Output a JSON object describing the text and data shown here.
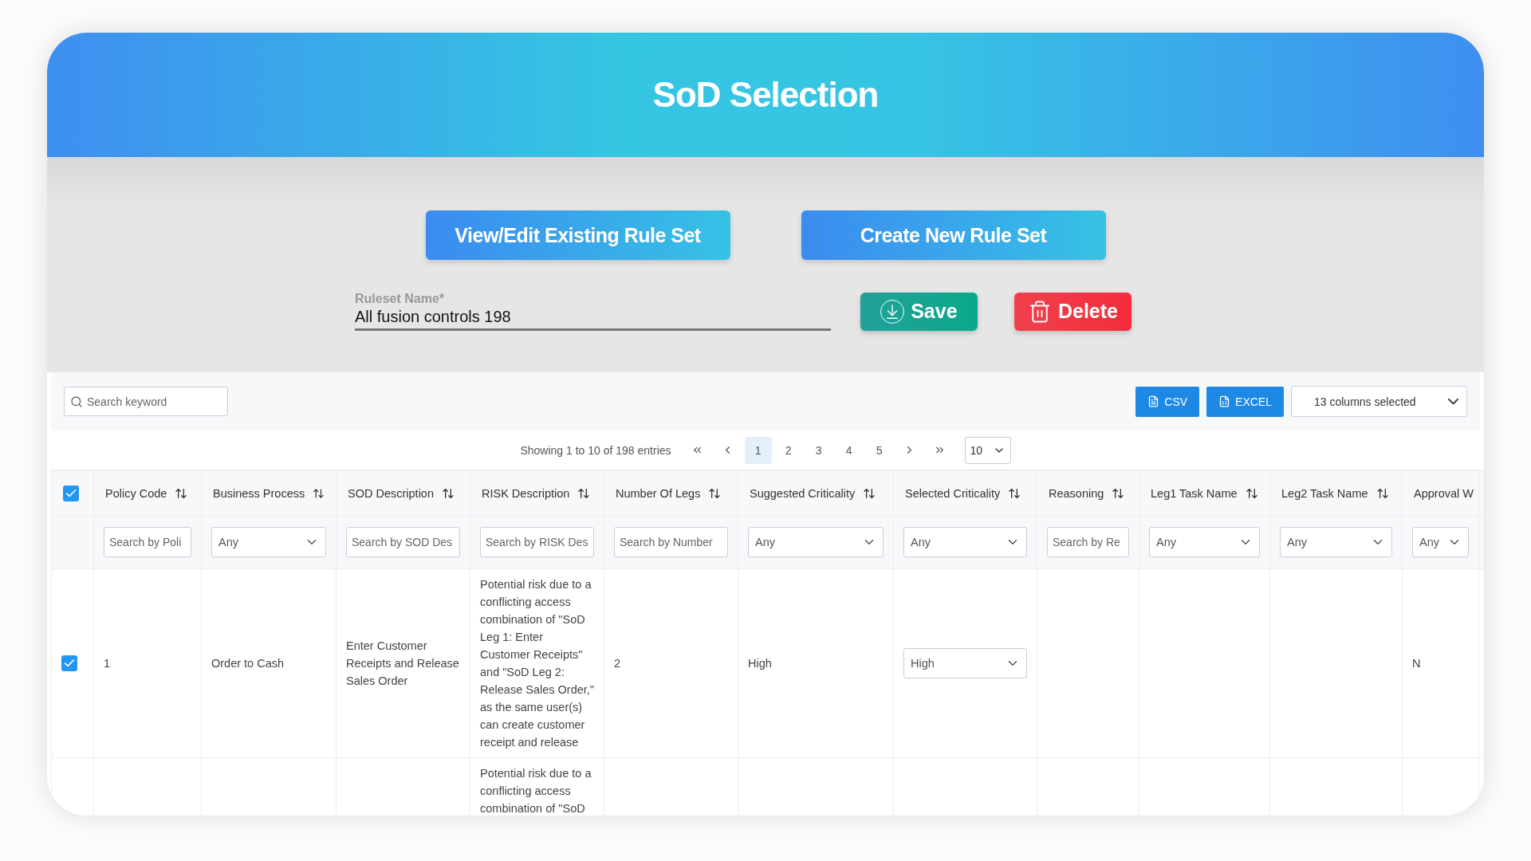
{
  "header": {
    "title": "SoD Selection"
  },
  "mode_buttons": [
    "View/Edit Existing Rule Set",
    "Create New Rule Set"
  ],
  "ruleset": {
    "label": "Ruleset Name*",
    "value": "All fusion controls 198"
  },
  "actions": {
    "save": "Save",
    "delete": "Delete"
  },
  "toolbar": {
    "search_placeholder": "Search keyword",
    "csv": "CSV",
    "excel": "EXCEL",
    "columns_select": "13 columns selected"
  },
  "pagination": {
    "summary": "Showing 1 to 10 of 198 entries",
    "pages": [
      {
        "label": "1",
        "selected": true
      },
      {
        "label": "2",
        "selected": false
      },
      {
        "label": "3",
        "selected": false
      },
      {
        "label": "4",
        "selected": false
      },
      {
        "label": "5",
        "selected": false
      }
    ],
    "page_size": "10"
  },
  "table": {
    "select_all_checked": true,
    "columns": [
      {
        "label": "Policy Code",
        "sortable": true,
        "filter": {
          "kind": "text",
          "placeholder": "Search by Poli"
        }
      },
      {
        "label": "Business Process",
        "sortable": true,
        "filter": {
          "kind": "select",
          "value": "Any"
        }
      },
      {
        "label": "SOD Description",
        "sortable": true,
        "filter": {
          "kind": "text",
          "placeholder": "Search by SOD Des"
        }
      },
      {
        "label": "RISK Description",
        "sortable": true,
        "filter": {
          "kind": "text",
          "placeholder": "Search by RISK Des"
        }
      },
      {
        "label": "Number Of Legs",
        "sortable": true,
        "filter": {
          "kind": "text",
          "placeholder": "Search by Number"
        }
      },
      {
        "label": "Suggested Criticality",
        "sortable": true,
        "filter": {
          "kind": "select",
          "value": "Any"
        }
      },
      {
        "label": "Selected Criticality",
        "sortable": true,
        "filter": {
          "kind": "select",
          "value": "Any"
        }
      },
      {
        "label": "Reasoning",
        "sortable": true,
        "filter": {
          "kind": "text",
          "placeholder": "Search by Re"
        }
      },
      {
        "label": "Leg1 Task Name",
        "sortable": true,
        "filter": {
          "kind": "select",
          "value": "Any"
        }
      },
      {
        "label": "Leg2 Task Name",
        "sortable": true,
        "filter": {
          "kind": "select",
          "value": "Any"
        }
      },
      {
        "label": "Approval W",
        "sortable": false,
        "filter": {
          "kind": "select",
          "value": "Any"
        }
      }
    ],
    "rows": [
      {
        "checked": true,
        "policy_code": "1",
        "business_process": "Order to Cash",
        "sod_description": "Enter Customer Receipts and Release Sales Order",
        "risk_description": "Potential risk due to a conflicting access combination of \"SoD Leg 1: Enter Customer Receipts\" and \"SoD Leg 2: Release Sales Order,\" as the same user(s) can create customer receipt and release",
        "number_of_legs": "2",
        "suggested_criticality": "High",
        "selected_criticality": {
          "kind": "select",
          "value": "High"
        },
        "approval": "N"
      },
      {
        "risk_description": "Potential risk due to a conflicting access combination of \"SoD"
      }
    ]
  }
}
